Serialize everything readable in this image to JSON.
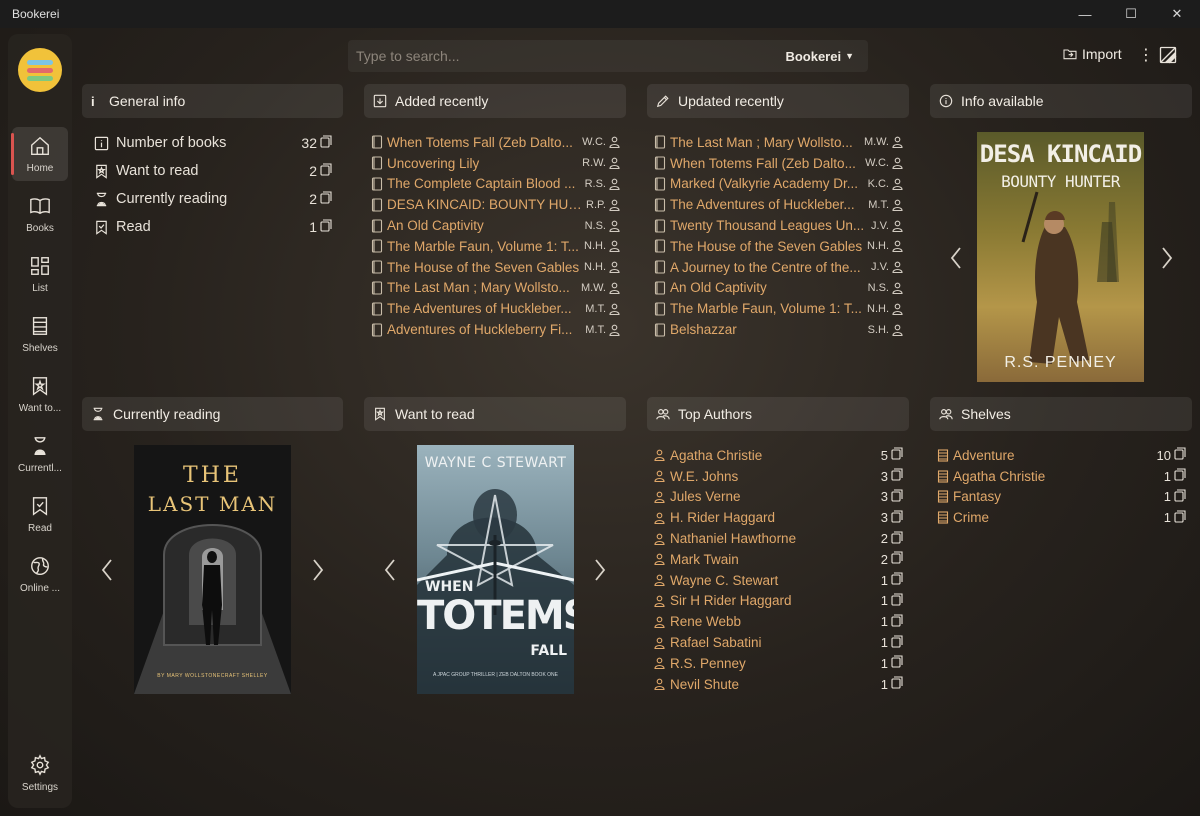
{
  "window": {
    "title": "Bookerei",
    "minimize": "—",
    "maximize": "☐",
    "close": "✕"
  },
  "sidebar": {
    "items": [
      {
        "label": "Home",
        "icon": "home-icon"
      },
      {
        "label": "Books",
        "icon": "book-open-icon"
      },
      {
        "label": "List",
        "icon": "grid-icon"
      },
      {
        "label": "Shelves",
        "icon": "shelves-icon"
      },
      {
        "label": "Want to...",
        "icon": "bookmark-star-icon"
      },
      {
        "label": "Currentl...",
        "icon": "hourglass-icon"
      },
      {
        "label": "Read",
        "icon": "bookmark-check-icon"
      },
      {
        "label": "Online ...",
        "icon": "globe-icon"
      },
      {
        "label": "Settings",
        "icon": "gear-icon"
      }
    ]
  },
  "topbar": {
    "search_placeholder": "Type to search...",
    "library": "Bookerei",
    "import_label": "Import"
  },
  "general_info": {
    "title": "General info",
    "rows": [
      {
        "label": "Number of books",
        "count": "32"
      },
      {
        "label": "Want to read",
        "count": "2"
      },
      {
        "label": "Currently reading",
        "count": "2"
      },
      {
        "label": "Read",
        "count": "1"
      }
    ]
  },
  "added_recently": {
    "title": "Added recently",
    "books": [
      {
        "title": "When Totems Fall (Zeb Dalto...",
        "author": "W.C."
      },
      {
        "title": "Uncovering Lily",
        "author": "R.W."
      },
      {
        "title": "The Complete Captain Blood ...",
        "author": "R.S."
      },
      {
        "title": "DESA KINCAID: BOUNTY HUN...",
        "author": "R.P."
      },
      {
        "title": "An Old Captivity",
        "author": "N.S."
      },
      {
        "title": "The Marble Faun, Volume 1: T...",
        "author": "N.H."
      },
      {
        "title": "The House of the Seven Gables",
        "author": "N.H."
      },
      {
        "title": "The Last Man ; Mary Wollsto...",
        "author": "M.W."
      },
      {
        "title": "The Adventures of Huckleber...",
        "author": "M.T."
      },
      {
        "title": "Adventures of Huckleberry Fi...",
        "author": "M.T."
      }
    ]
  },
  "updated_recently": {
    "title": "Updated recently",
    "books": [
      {
        "title": "The Last Man ; Mary Wollsto...",
        "author": "M.W."
      },
      {
        "title": "When Totems Fall (Zeb Dalto...",
        "author": "W.C."
      },
      {
        "title": "Marked (Valkyrie Academy Dr...",
        "author": "K.C."
      },
      {
        "title": "The Adventures of Huckleber...",
        "author": "M.T."
      },
      {
        "title": "Twenty Thousand Leagues Un...",
        "author": "J.V."
      },
      {
        "title": "The House of the Seven Gables",
        "author": "N.H."
      },
      {
        "title": "A Journey to the Centre of the...",
        "author": "J.V."
      },
      {
        "title": "An Old Captivity",
        "author": "N.S."
      },
      {
        "title": "The Marble Faun, Volume 1: T...",
        "author": "N.H."
      },
      {
        "title": "Belshazzar",
        "author": "S.H."
      }
    ]
  },
  "info_available": {
    "title": "Info available",
    "cover": {
      "title_line1": "DESA KINCAID",
      "title_line2": "BOUNTY HUNTER",
      "author": "R.S. PENNEY"
    }
  },
  "currently_reading": {
    "title": "Currently reading",
    "cover": {
      "title_line1": "THE",
      "title_line2": "LAST MAN",
      "author": "BY MARY WOLLSTONECRAFT SHELLEY"
    }
  },
  "want_to_read": {
    "title": "Want to read",
    "cover": {
      "author": "WAYNE C STEWART",
      "title_line1": "WHEN",
      "title_line2": "TOTEMS",
      "title_line3": "FALL",
      "tagline": "A JPAC GROUP THRILLER | ZEB DALTON BOOK ONE"
    }
  },
  "top_authors": {
    "title": "Top Authors",
    "authors": [
      {
        "name": "Agatha Christie",
        "count": "5"
      },
      {
        "name": "W.E. Johns",
        "count": "3"
      },
      {
        "name": "Jules Verne",
        "count": "3"
      },
      {
        "name": "H. Rider Haggard",
        "count": "3"
      },
      {
        "name": "Nathaniel Hawthorne",
        "count": "2"
      },
      {
        "name": "Mark Twain",
        "count": "2"
      },
      {
        "name": "Wayne C. Stewart",
        "count": "1"
      },
      {
        "name": "Sir H Rider Haggard",
        "count": "1"
      },
      {
        "name": "Rene Webb",
        "count": "1"
      },
      {
        "name": "Rafael Sabatini",
        "count": "1"
      },
      {
        "name": "R.S. Penney",
        "count": "1"
      },
      {
        "name": "Nevil Shute",
        "count": "1"
      }
    ]
  },
  "shelves": {
    "title": "Shelves",
    "items": [
      {
        "name": "Adventure",
        "count": "10"
      },
      {
        "name": "Agatha Christie",
        "count": "1"
      },
      {
        "name": "Fantasy",
        "count": "1"
      },
      {
        "name": "Crime",
        "count": "1"
      }
    ]
  },
  "colors": {
    "accent": "#e0a86a",
    "active_marker": "#d9544f",
    "logo": "#f1c23a"
  }
}
